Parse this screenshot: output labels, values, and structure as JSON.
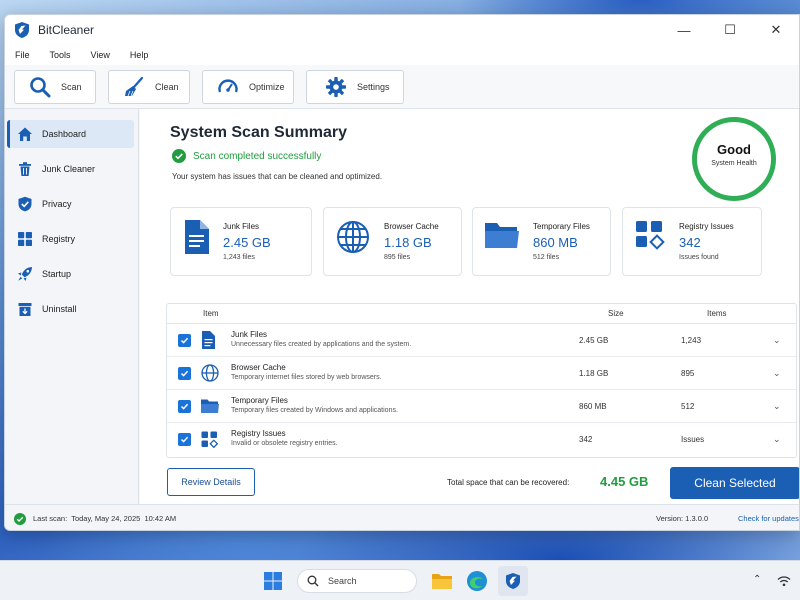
{
  "window": {
    "title": "BitCleaner",
    "controls": {
      "minimize": "—",
      "maximize": "☐",
      "close": "✕"
    }
  },
  "menu": [
    "File",
    "Tools",
    "View",
    "Help"
  ],
  "toolbar": {
    "scan": "Scan",
    "clean": "Clean",
    "optimize": "Optimize",
    "settings": "Settings"
  },
  "sidebar": {
    "items": [
      {
        "label": "Dashboard",
        "icon": "home-icon",
        "active": true
      },
      {
        "label": "Junk Cleaner",
        "icon": "trash-icon",
        "active": false
      },
      {
        "label": "Privacy",
        "icon": "shield-check-icon",
        "active": false
      },
      {
        "label": "Registry",
        "icon": "grid-icon",
        "active": false
      },
      {
        "label": "Startup",
        "icon": "rocket-icon",
        "active": false
      },
      {
        "label": "Uninstall",
        "icon": "uninstall-box-icon",
        "active": false
      }
    ]
  },
  "summary": {
    "title": "System Scan Summary",
    "status": "Scan completed successfully",
    "subtitle": "Your system has issues that can be cleaned and optimized.",
    "health_value": "Good",
    "health_label": "System Health"
  },
  "cards": [
    {
      "title": "Junk Files",
      "value": "2.45 GB",
      "sub": "1,243 files",
      "icon": "document-icon"
    },
    {
      "title": "Browser Cache",
      "value": "1.18 GB",
      "sub": "895 files",
      "icon": "globe-icon"
    },
    {
      "title": "Temporary Files",
      "value": "860 MB",
      "sub": "512 files",
      "icon": "folder-icon"
    },
    {
      "title": "Registry Issues",
      "value": "342",
      "sub": "Issues found",
      "icon": "registry-icon"
    }
  ],
  "table": {
    "headers": {
      "item": "Item",
      "size": "Size",
      "items": "Items"
    },
    "rows": [
      {
        "title": "Junk Files",
        "desc": "Unnecessary files created by applications and the system.",
        "size": "2.45 GB",
        "items": "1,243",
        "checked": true
      },
      {
        "title": "Browser Cache",
        "desc": "Temporary internet files stored by web browsers.",
        "size": "1.18 GB",
        "items": "895",
        "checked": true
      },
      {
        "title": "Temporary Files",
        "desc": "Temporary files created by Windows and applications.",
        "size": "860 MB",
        "items": "512",
        "checked": true
      },
      {
        "title": "Registry Issues",
        "desc": "Invalid or obsolete registry entries.",
        "size": "342",
        "items": "Issues",
        "checked": true
      }
    ]
  },
  "actions": {
    "review": "Review Details",
    "recover_label": "Total space that can be recovered:",
    "recover_value": "4.45 GB",
    "clean_selected": "Clean Selected"
  },
  "status": {
    "last_scan": "Last scan:  Today, May 24, 2025  10:42 AM",
    "version": "Version: 1.3.0.0",
    "updates": "Check for updates"
  },
  "taskbar": {
    "search_placeholder": "Search"
  },
  "colors": {
    "accent": "#1a5fb4",
    "success": "#1f9d3f",
    "health_ring": "#2fae55"
  }
}
